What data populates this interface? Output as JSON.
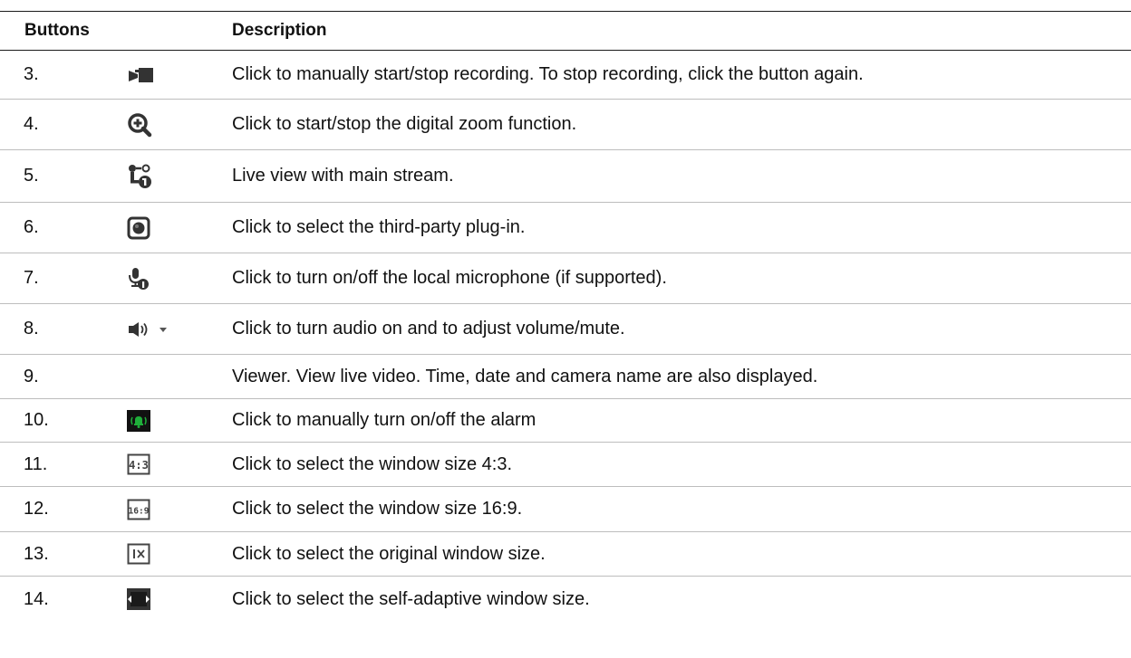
{
  "header": {
    "buttons_label": "Buttons",
    "description_label": "Description"
  },
  "rows": [
    {
      "num": "3.",
      "icon": "record-camera-icon",
      "desc": "Click to manually start/stop recording. To stop recording, click the button again."
    },
    {
      "num": "4.",
      "icon": "zoom-in-icon",
      "desc": "Click to start/stop the digital zoom function."
    },
    {
      "num": "5.",
      "icon": "main-stream-icon",
      "desc": "Live view with main stream."
    },
    {
      "num": "6.",
      "icon": "plugin-icon",
      "desc": "Click to select the third-party plug-in."
    },
    {
      "num": "7.",
      "icon": "microphone-icon",
      "desc": "Click to turn on/off the local microphone (if supported)."
    },
    {
      "num": "8.",
      "icon": "speaker-dropdown-icon",
      "desc": "Click to turn audio on and to adjust volume/mute."
    },
    {
      "num": "9.",
      "icon": "",
      "desc": "Viewer. View live video. Time, date and camera name are also displayed."
    },
    {
      "num": "10.",
      "icon": "alarm-icon",
      "desc": "Click to manually turn on/off the alarm"
    },
    {
      "num": "11.",
      "icon": "window-4-3-icon",
      "desc": "Click to select the window size 4:3."
    },
    {
      "num": "12.",
      "icon": "window-16-9-icon",
      "desc": "Click to select the window size 16:9."
    },
    {
      "num": "13.",
      "icon": "window-original-icon",
      "desc": "Click to select the original window size."
    },
    {
      "num": "14.",
      "icon": "window-self-adaptive-icon",
      "desc": "Click to select the self-adaptive window size."
    }
  ]
}
